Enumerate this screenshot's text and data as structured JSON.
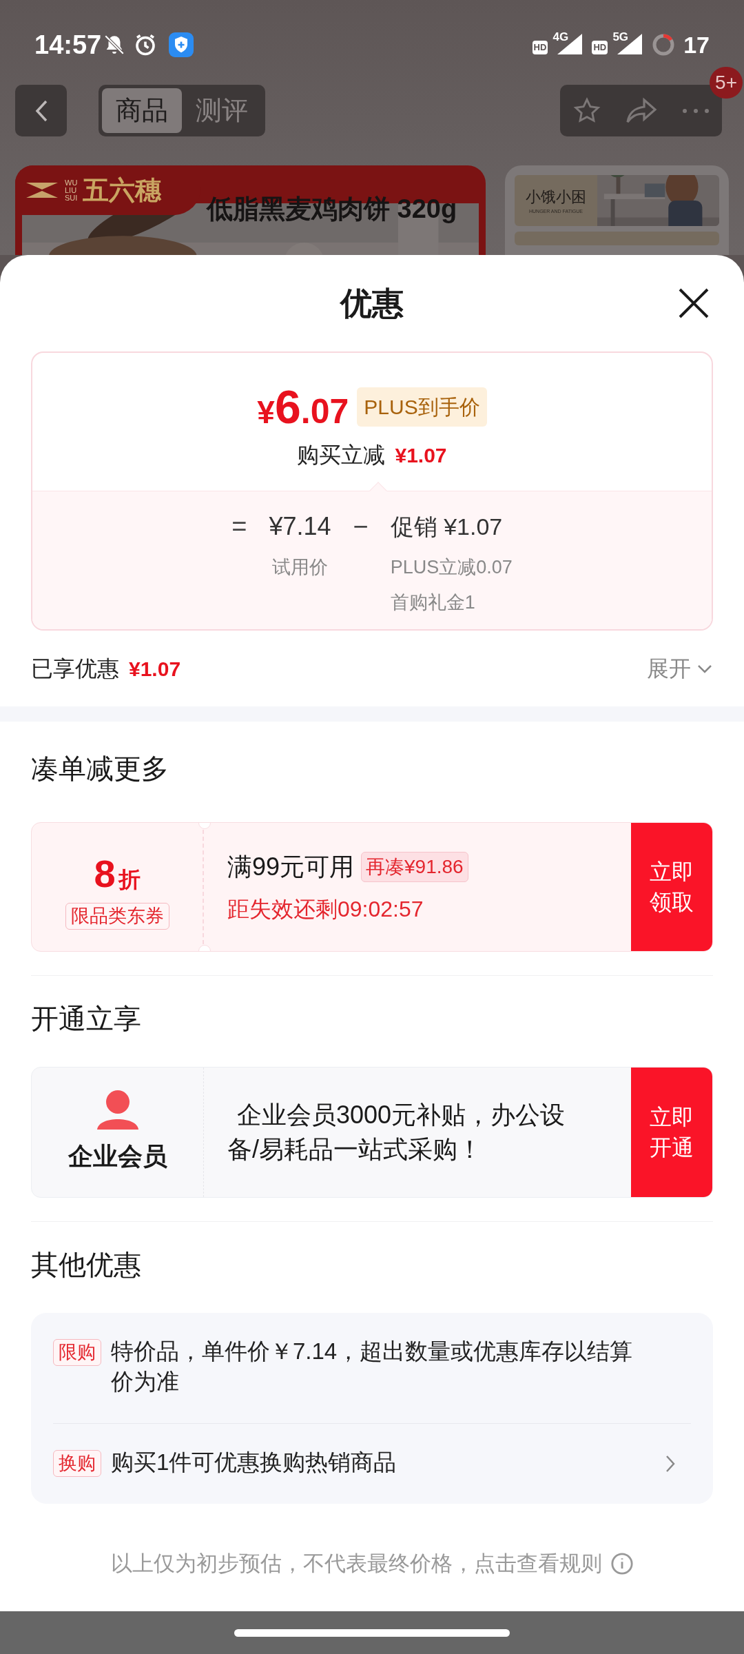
{
  "status_bar": {
    "time": "14:57",
    "hd_1": "HD",
    "net_1": "4G",
    "hd_2": "HD",
    "net_2": "5G",
    "battery": "17"
  },
  "page_header": {
    "tabs": [
      {
        "label": "商品",
        "selected": true
      },
      {
        "label": "测评",
        "selected": false
      }
    ],
    "badge": "5+"
  },
  "banner": {
    "brand_latin": [
      "WU",
      "LIU",
      "SUI"
    ],
    "brand": "五六穗",
    "product": "低脂黑麦鸡肉饼 320g"
  },
  "side_card": {
    "title": "小饿小困",
    "subtitle": "HUNGER AND FATIGUE"
  },
  "sheet": {
    "title": "优惠",
    "price_card": {
      "currency": "¥",
      "price_int": "6",
      "price_dec": ".07",
      "price_tag": "PLUS到手价",
      "instant_label": "购买立减",
      "instant_value": "¥1.07",
      "equals": "=",
      "base_price": "¥7.14",
      "base_label": "试用价",
      "minus": "−",
      "promo_label": "促销",
      "promo_value": "¥1.07",
      "promo_details": [
        "PLUS立减0.07",
        "首购礼金1"
      ]
    },
    "enjoyed": {
      "label": "已享优惠",
      "value": "¥1.07",
      "toggle": "展开",
      "expanded": false
    },
    "coupons": {
      "heading": "凑单减更多",
      "discount": "8",
      "unit": "折",
      "scope": "限品类东券",
      "condition": "满99元可用",
      "gap": "再凑¥91.86",
      "countdown": "距失效还剩09:02:57",
      "action": "立即领取"
    },
    "membership": {
      "heading": "开通立享",
      "name": "企业会员",
      "desc": "企业会员3000元补贴，办公设备/易耗品一站式采购！",
      "action": "立即开通"
    },
    "other": {
      "heading": "其他优惠",
      "items": [
        {
          "tag": "限购",
          "text": "特价品，单件价￥7.14，超出数量或优惠库存以结算价为准",
          "has_arrow": false
        },
        {
          "tag": "换购",
          "text": "购买1件可优惠换购热销商品",
          "has_arrow": true
        }
      ]
    },
    "footer": "以上仅为初步预估，不代表最终价格，点击查看规则"
  }
}
